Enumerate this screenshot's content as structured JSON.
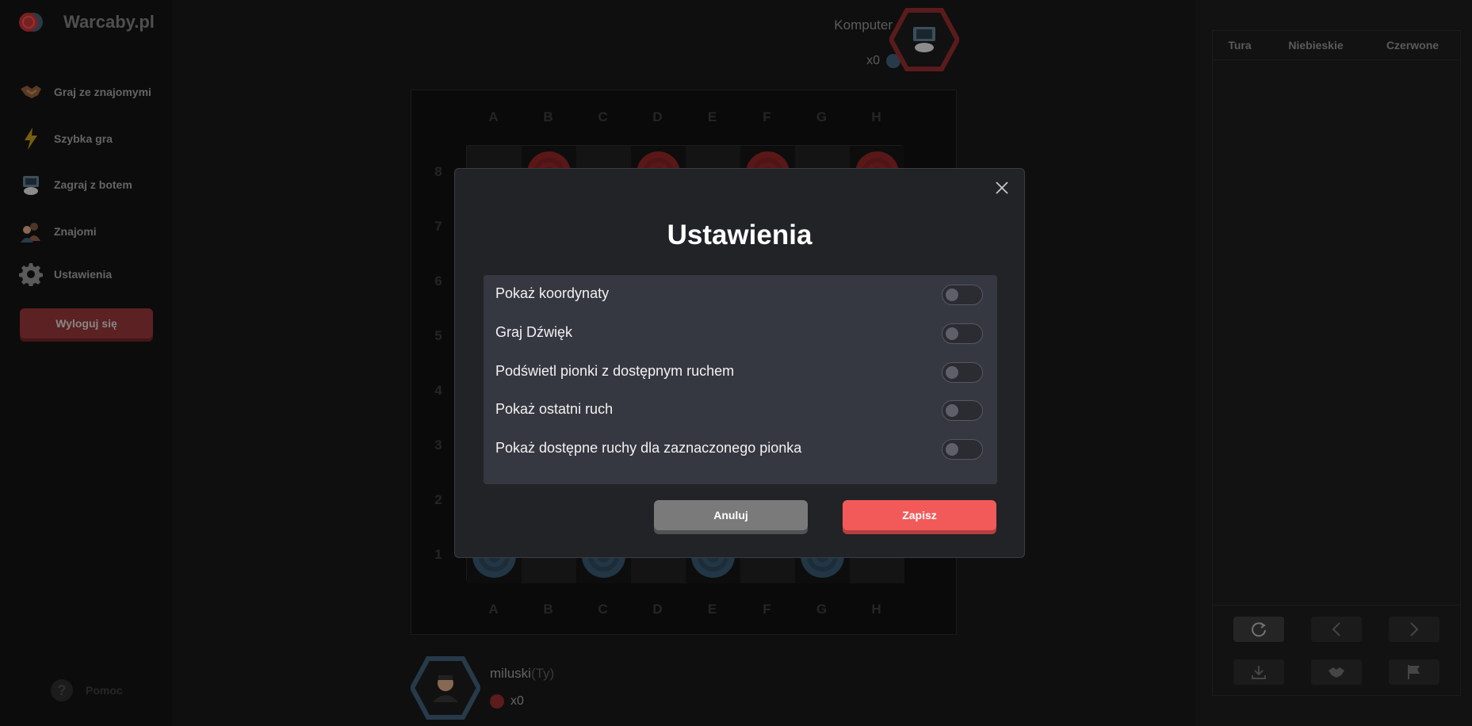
{
  "sidebar": {
    "logo_text": "Warcaby.pl",
    "items": [
      {
        "label": "Graj ze znajomymi",
        "icon": "handshake-icon"
      },
      {
        "label": "Szybka gra",
        "icon": "lightning-icon"
      },
      {
        "label": "Zagraj z botem",
        "icon": "robot-icon"
      },
      {
        "label": "Znajomi",
        "icon": "friends-icon"
      },
      {
        "label": "Ustawienia",
        "icon": "gear-icon"
      }
    ],
    "logout_label": "Wyloguj się",
    "help_symbol": "?",
    "help_label": "Pomoc"
  },
  "opponent": {
    "name": "Komputer",
    "count": "x0",
    "piece_color": "#3c5a72"
  },
  "player": {
    "name": "miluski",
    "tag": "(Ty)",
    "count": "x0",
    "piece_color": "#8e2a2c"
  },
  "board": {
    "columns": [
      "A",
      "B",
      "C",
      "D",
      "E",
      "F",
      "G",
      "H"
    ],
    "rows": [
      "8",
      "7",
      "6",
      "5",
      "4",
      "3",
      "2",
      "1"
    ]
  },
  "moves_table": {
    "headers": [
      "Tura",
      "Niebieskie",
      "Czerwone"
    ],
    "controls": [
      "refresh-icon",
      "prev-icon",
      "next-icon",
      "download-icon",
      "draw-offer-icon",
      "flag-icon"
    ]
  },
  "modal": {
    "title": "Ustawienia",
    "settings": [
      {
        "label": "Pokaż koordynaty",
        "enabled": false
      },
      {
        "label": "Graj Dźwięk",
        "enabled": false
      },
      {
        "label": "Podświetl pionki z dostępnym ruchem",
        "enabled": false
      },
      {
        "label": "Pokaż ostatni ruch",
        "enabled": false
      },
      {
        "label": "Pokaż dostępne ruchy dla zaznaczonego pionka",
        "enabled": false
      }
    ],
    "cancel_label": "Anuluj",
    "save_label": "Zapisz"
  },
  "colors": {
    "accent_red": "#f25a5a",
    "blue_piece": "#35536a",
    "red_piece": "#8a2426"
  }
}
